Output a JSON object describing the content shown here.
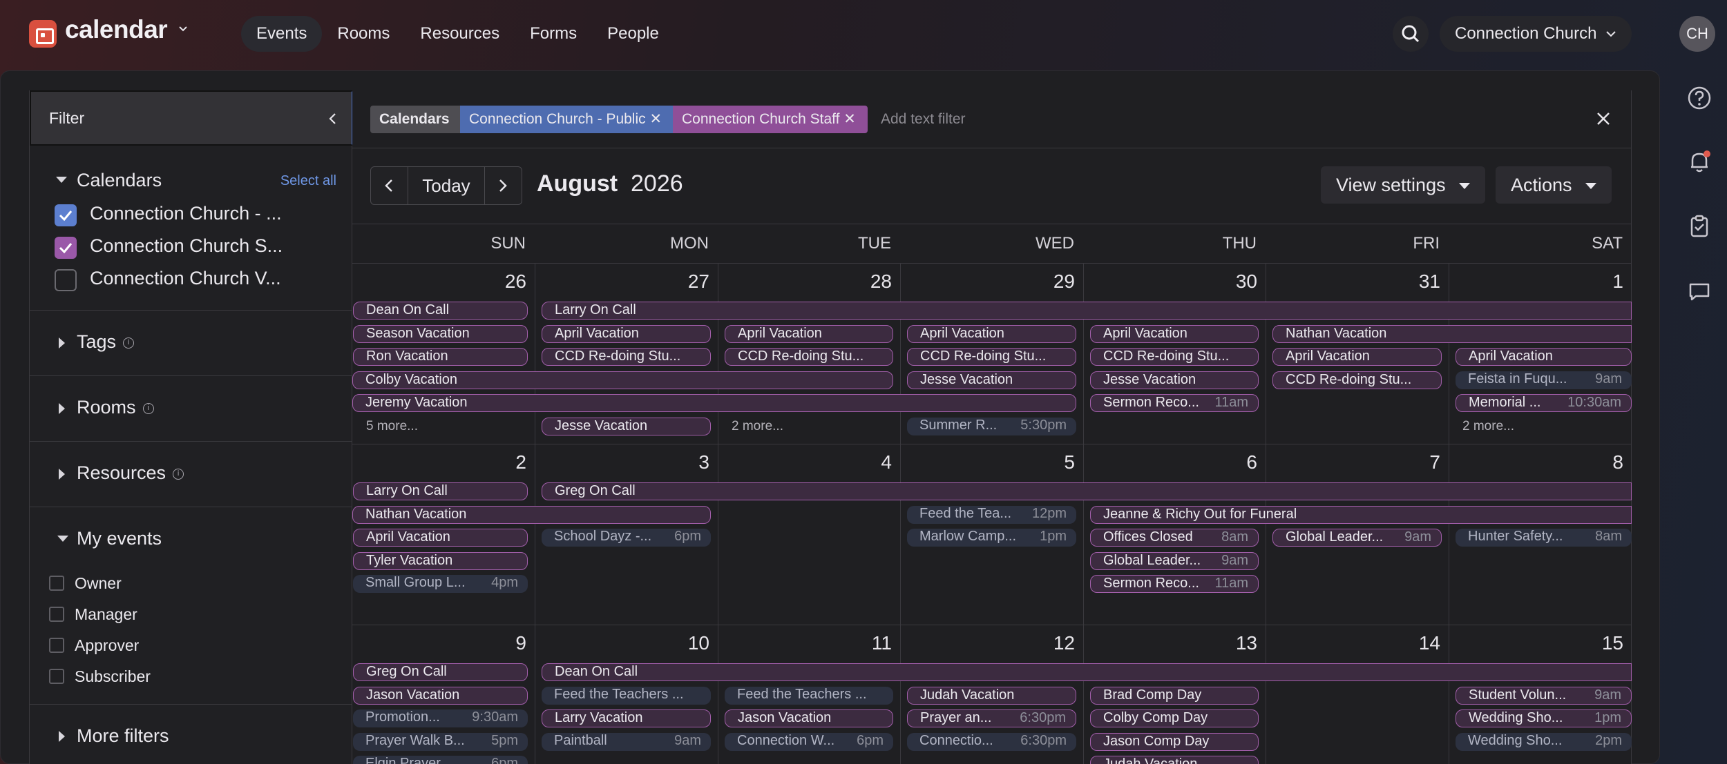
{
  "app": {
    "name": "calendar",
    "org": "Connection Church",
    "avatar": "CH"
  },
  "nav": [
    "Events",
    "Rooms",
    "Resources",
    "Forms",
    "People"
  ],
  "sidebar": {
    "filter_title": "Filter",
    "calendars_title": "Calendars",
    "select_all": "Select all",
    "calendars": [
      {
        "label": "Connection Church - ...",
        "checked": true,
        "color": "#5c7fcf"
      },
      {
        "label": "Connection Church S...",
        "checked": true,
        "color": "#9a58a8"
      },
      {
        "label": "Connection Church V...",
        "checked": false
      }
    ],
    "tags": "Tags",
    "rooms": "Rooms",
    "resources": "Resources",
    "my_events": "My events",
    "my_event_opts": [
      "Owner",
      "Manager",
      "Approver",
      "Subscriber"
    ],
    "more_filters": "More filters"
  },
  "filterbar": {
    "label": "Calendars",
    "chips": [
      "Connection Church - Public",
      "Connection Church Staff"
    ],
    "add_placeholder": "Add text filter"
  },
  "toolbar": {
    "today": "Today",
    "month": "August",
    "year": "2026",
    "view_settings": "View settings",
    "actions": "Actions"
  },
  "days": [
    "SUN",
    "MON",
    "TUE",
    "WED",
    "THU",
    "FRI",
    "SAT"
  ],
  "weeks": [
    {
      "dates": [
        "26",
        "27",
        "28",
        "29",
        "30",
        "31",
        "1"
      ],
      "events": [
        {
          "t": "Dean On Call",
          "c": 0,
          "s": 1,
          "r": 0
        },
        {
          "t": "Larry On Call",
          "c": 1,
          "s": 6,
          "r": 0
        },
        {
          "t": "Season Vacation",
          "c": 0,
          "s": 1,
          "r": 1
        },
        {
          "t": "April Vacation",
          "c": 1,
          "s": 1,
          "r": 1
        },
        {
          "t": "April Vacation",
          "c": 2,
          "s": 1,
          "r": 1
        },
        {
          "t": "April Vacation",
          "c": 3,
          "s": 1,
          "r": 1
        },
        {
          "t": "April Vacation",
          "c": 4,
          "s": 1,
          "r": 1
        },
        {
          "t": "Nathan Vacation",
          "c": 5,
          "s": 2,
          "r": 1
        },
        {
          "t": "Ron Vacation",
          "c": 0,
          "s": 1,
          "r": 2
        },
        {
          "t": "CCD Re-doing Stu...",
          "c": 1,
          "s": 1,
          "r": 2
        },
        {
          "t": "CCD Re-doing Stu...",
          "c": 2,
          "s": 1,
          "r": 2
        },
        {
          "t": "CCD Re-doing Stu...",
          "c": 3,
          "s": 1,
          "r": 2
        },
        {
          "t": "CCD Re-doing Stu...",
          "c": 4,
          "s": 1,
          "r": 2
        },
        {
          "t": "April Vacation",
          "c": 5,
          "s": 1,
          "r": 2
        },
        {
          "t": "April Vacation",
          "c": 6,
          "s": 1,
          "r": 2
        },
        {
          "t": "Colby Vacation",
          "c": 0,
          "s": 3,
          "r": 3
        },
        {
          "t": "Jesse Vacation",
          "c": 3,
          "s": 1,
          "r": 3
        },
        {
          "t": "Jesse Vacation",
          "c": 4,
          "s": 1,
          "r": 3
        },
        {
          "t": "CCD Re-doing Stu...",
          "c": 5,
          "s": 1,
          "r": 3
        },
        {
          "t": "Feista in Fuqu...",
          "tm": "9am",
          "c": 6,
          "s": 1,
          "r": 3,
          "pub": true
        },
        {
          "t": "Jeremy Vacation",
          "c": 0,
          "s": 4,
          "r": 4
        },
        {
          "t": "Sermon Reco...",
          "tm": "11am",
          "c": 4,
          "s": 1,
          "r": 4
        },
        {
          "t": "Memorial ...",
          "tm": "10:30am",
          "c": 6,
          "s": 1,
          "r": 4
        },
        {
          "t": "Jesse Vacation",
          "c": 1,
          "s": 1,
          "r": 5
        },
        {
          "t": "Summer R...",
          "tm": "5:30pm",
          "c": 3,
          "s": 1,
          "r": 5,
          "pub": true
        }
      ],
      "more": [
        {
          "c": 0,
          "t": "5 more..."
        },
        {
          "c": 2,
          "t": "2 more..."
        },
        {
          "c": 6,
          "t": "2 more..."
        }
      ]
    },
    {
      "dates": [
        "2",
        "3",
        "4",
        "5",
        "6",
        "7",
        "8"
      ],
      "events": [
        {
          "t": "Larry On Call",
          "c": 0,
          "s": 1,
          "r": 0
        },
        {
          "t": "Greg On Call",
          "c": 1,
          "s": 6,
          "r": 0
        },
        {
          "t": "Nathan Vacation",
          "c": 0,
          "s": 2,
          "r": 1
        },
        {
          "t": "Feed the Tea...",
          "tm": "12pm",
          "c": 3,
          "s": 1,
          "r": 1,
          "pub": true
        },
        {
          "t": "Jeanne & Richy Out for Funeral",
          "c": 4,
          "s": 3,
          "r": 1
        },
        {
          "t": "April Vacation",
          "c": 0,
          "s": 1,
          "r": 2
        },
        {
          "t": "School Dayz -...",
          "tm": "6pm",
          "c": 1,
          "s": 1,
          "r": 2,
          "pub": true
        },
        {
          "t": "Marlow Camp...",
          "tm": "1pm",
          "c": 3,
          "s": 1,
          "r": 2,
          "pub": true
        },
        {
          "t": "Offices Closed",
          "tm": "8am",
          "c": 4,
          "s": 1,
          "r": 2
        },
        {
          "t": "Global Leader...",
          "tm": "9am",
          "c": 5,
          "s": 1,
          "r": 2
        },
        {
          "t": "Hunter Safety...",
          "tm": "8am",
          "c": 6,
          "s": 1,
          "r": 2,
          "pub": true
        },
        {
          "t": "Tyler Vacation",
          "c": 0,
          "s": 1,
          "r": 3
        },
        {
          "t": "Global Leader...",
          "tm": "9am",
          "c": 4,
          "s": 1,
          "r": 3
        },
        {
          "t": "Small Group L...",
          "tm": "4pm",
          "c": 0,
          "s": 1,
          "r": 4,
          "pub": true
        },
        {
          "t": "Sermon Reco...",
          "tm": "11am",
          "c": 4,
          "s": 1,
          "r": 4
        }
      ],
      "more": []
    },
    {
      "dates": [
        "9",
        "10",
        "11",
        "12",
        "13",
        "14",
        "15"
      ],
      "events": [
        {
          "t": "Greg On Call",
          "c": 0,
          "s": 1,
          "r": 0
        },
        {
          "t": "Dean On Call",
          "c": 1,
          "s": 6,
          "r": 0
        },
        {
          "t": "Jason Vacation",
          "c": 0,
          "s": 1,
          "r": 1
        },
        {
          "t": "Feed the Teachers ...",
          "c": 1,
          "s": 1,
          "r": 1,
          "pub": true
        },
        {
          "t": "Feed the Teachers ...",
          "c": 2,
          "s": 1,
          "r": 1,
          "pub": true
        },
        {
          "t": "Judah Vacation",
          "c": 3,
          "s": 1,
          "r": 1
        },
        {
          "t": "Brad Comp Day",
          "c": 4,
          "s": 1,
          "r": 1
        },
        {
          "t": "Student Volun...",
          "tm": "9am",
          "c": 6,
          "s": 1,
          "r": 1
        },
        {
          "t": "Promotion...",
          "tm": "9:30am",
          "c": 0,
          "s": 1,
          "r": 2,
          "pub": true
        },
        {
          "t": "Larry Vacation",
          "c": 1,
          "s": 1,
          "r": 2
        },
        {
          "t": "Jason Vacation",
          "c": 2,
          "s": 1,
          "r": 2
        },
        {
          "t": "Prayer an...",
          "tm": "6:30pm",
          "c": 3,
          "s": 1,
          "r": 2
        },
        {
          "t": "Colby Comp Day",
          "c": 4,
          "s": 1,
          "r": 2
        },
        {
          "t": "Wedding Sho...",
          "tm": "1pm",
          "c": 6,
          "s": 1,
          "r": 2
        },
        {
          "t": "Prayer Walk B...",
          "tm": "5pm",
          "c": 0,
          "s": 1,
          "r": 3,
          "pub": true
        },
        {
          "t": "Paintball",
          "tm": "9am",
          "c": 1,
          "s": 1,
          "r": 3,
          "pub": true
        },
        {
          "t": "Connection W...",
          "tm": "6pm",
          "c": 2,
          "s": 1,
          "r": 3,
          "pub": true
        },
        {
          "t": "Connectio...",
          "tm": "6:30pm",
          "c": 3,
          "s": 1,
          "r": 3,
          "pub": true
        },
        {
          "t": "Jason Comp Day",
          "c": 4,
          "s": 1,
          "r": 3
        },
        {
          "t": "Wedding Sho...",
          "tm": "2pm",
          "c": 6,
          "s": 1,
          "r": 3,
          "pub": true
        },
        {
          "t": "Elgin Prayer...",
          "tm": "6pm",
          "c": 0,
          "s": 1,
          "r": 4,
          "pub": true
        },
        {
          "t": "Judah Vacation",
          "c": 4,
          "s": 1,
          "r": 4
        }
      ],
      "more": []
    }
  ]
}
